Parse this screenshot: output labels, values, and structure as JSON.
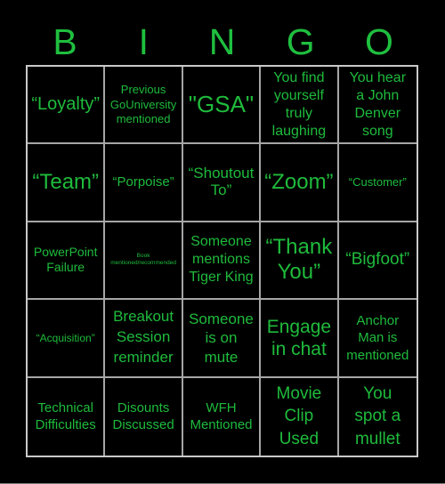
{
  "title_letters": [
    "B",
    "I",
    "N",
    "G",
    "O"
  ],
  "colors": {
    "background": "#000000",
    "text_green": "#1fbf3f",
    "grid_line": "#a6a6a6"
  },
  "board": {
    "cells": [
      "“Loyalty”",
      "Previous\nGoUniversity\nmentioned",
      "\"GSA\"",
      "You find\nyourself\ntruly\nlaughing",
      "You hear\na John\nDenver\nsong",
      "“Team”",
      "“Porpoise”",
      "“Shoutout\nTo”",
      "“Zoom”",
      "“Customer”",
      "PowerPoint\nFailure",
      "Book\nmentioned/recommended",
      "Someone\nmentions\nTiger King",
      "“Thank\nYou”",
      "“Bigfoot”",
      "“Acquisition”",
      "Breakout\nSession\nreminder",
      "Someone\nis on\nmute",
      "Engage\nin chat",
      "Anchor\nMan is\nmentioned",
      "Technical\nDifficulties",
      "Disounts\nDiscussed",
      "WFH\nMentioned",
      "Movie\nClip\nUsed",
      "You\nspot a\nmullet"
    ]
  }
}
